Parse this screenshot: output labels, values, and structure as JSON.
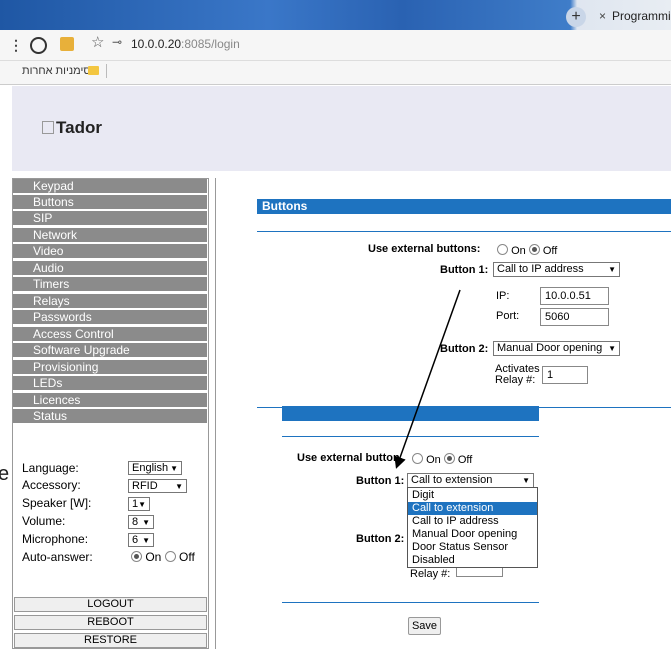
{
  "browser": {
    "tab_title": "Programmin",
    "tab_close": "×",
    "tab_add": "+",
    "url_host": "10.0.0.20",
    "url_rest": ":8085/login",
    "bookmarks_label": "סימניות אחרות"
  },
  "header": {
    "logo_alt": "Tador"
  },
  "sidebar": {
    "nav": [
      "Keypad",
      "Buttons",
      "SIP",
      "Network",
      "Video",
      "Audio",
      "Timers",
      "Relays",
      "Passwords",
      "Access Control",
      "Software Upgrade",
      "Provisioning",
      "LEDs",
      "Licences",
      "Status"
    ],
    "settings": {
      "language_label": "Language:",
      "language_value": "English",
      "accessory_label": "Accessory:",
      "accessory_value": "RFID",
      "speaker_label": "Speaker [W]:",
      "speaker_value": "1",
      "volume_label": "Volume:",
      "volume_value": "8",
      "microphone_label": "Microphone:",
      "microphone_value": "6",
      "autoanswer_label": "Auto-answer:",
      "on_label": "On",
      "off_label": "Off"
    },
    "actions": [
      "LOGOUT",
      "REBOOT",
      "RESTORE"
    ]
  },
  "main": {
    "title": "Buttons",
    "use_external_label": "Use external buttons:",
    "on_label": "On",
    "off_label": "Off",
    "button1_label": "Button 1:",
    "button1_value": "Call to IP address",
    "ip_label": "IP:",
    "ip_value": "10.0.0.51",
    "port_label": "Port:",
    "port_value": "5060",
    "button2_label": "Button 2:",
    "button2_value": "Manual Door opening",
    "activates_label_1": "Activates",
    "activates_label_2": "Relay #:",
    "relay_value": "1"
  },
  "overlay": {
    "use_external_label": "Use external button",
    "on_label": "On",
    "off_label": "Off",
    "button1_label": "Button 1:",
    "button1_value": "Call to extension",
    "button2_label": "Button 2:",
    "relay_label": "Relay #:",
    "options": [
      "Digit",
      "Call to extension",
      "Call to IP address",
      "Manual Door opening",
      "Door Status Sensor",
      "Disabled"
    ],
    "highlighted_option": "Call to extension",
    "save_label": "Save"
  },
  "edge_text": "e",
  "colors": {
    "accent": "#1e73c0",
    "nav_bg": "#8b8b8b",
    "header_bg": "#e9e9f3"
  }
}
